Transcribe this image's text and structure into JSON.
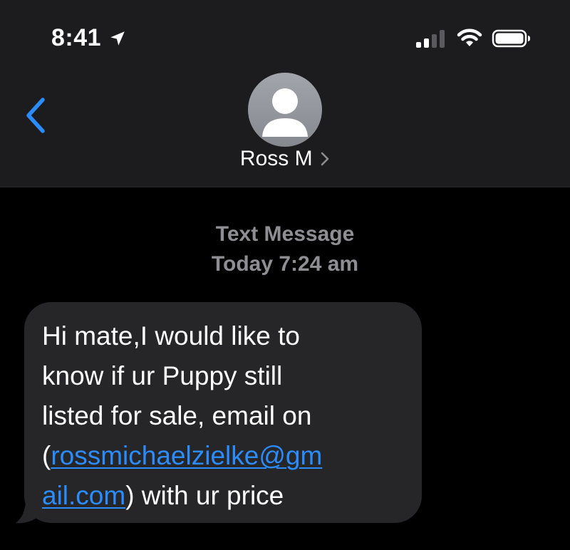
{
  "status_bar": {
    "time": "8:41",
    "icons": [
      "location-arrow-icon",
      "cellular-signal-icon",
      "wifi-icon",
      "battery-icon"
    ]
  },
  "header": {
    "back_icon": "chevron-left-icon",
    "contact_name": "Ross M",
    "contact_chevron_icon": "chevron-right-icon",
    "avatar_icon": "person-silhouette-icon"
  },
  "conversation": {
    "service_label": "Text Message",
    "timestamp": "Today 7:24 am",
    "messages": [
      {
        "direction": "incoming",
        "lines": [
          "Hi mate,I would like to",
          "know if ur Puppy still",
          "listed for sale, email on"
        ],
        "line4_prefix": "(",
        "email_part1": "rossmichaelzielke@gm",
        "email_part2": "ail.com",
        "line5_suffix": ") with ur price"
      }
    ]
  },
  "colors": {
    "background": "#000000",
    "header_background": "#1c1c1e",
    "bubble_background": "#262628",
    "accent_blue": "#2a8cff",
    "secondary_text": "#8e8e93"
  }
}
